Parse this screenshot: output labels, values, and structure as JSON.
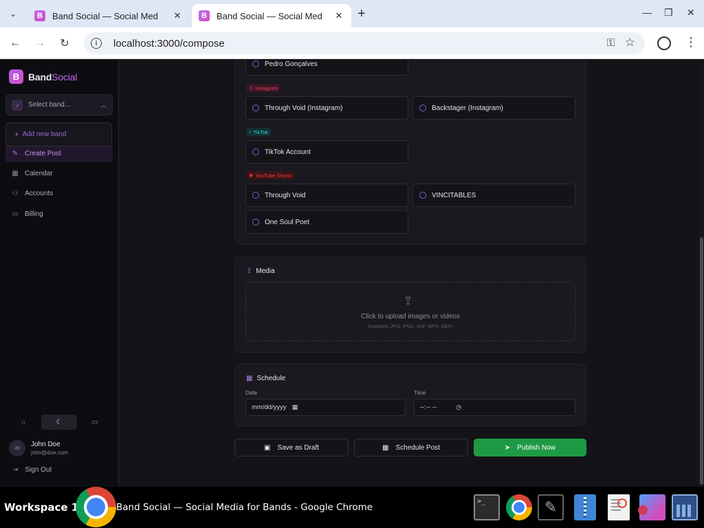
{
  "browser": {
    "tabs": [
      {
        "title": "Band Social — Social Med",
        "active": false
      },
      {
        "title": "Band Social — Social Med",
        "active": true
      }
    ],
    "url": "localhost:3000/compose"
  },
  "sidebar": {
    "brand_first": "Band",
    "brand_second": "Social",
    "band_select_placeholder": "Select band...",
    "dropdown_add_band": "Add new band",
    "nav": [
      {
        "label": "Create Post",
        "icon": "edit-icon",
        "active": true
      },
      {
        "label": "Calendar",
        "icon": "calendar-icon",
        "active": false
      },
      {
        "label": "Accounts",
        "icon": "user-icon",
        "active": false
      },
      {
        "label": "Billing",
        "icon": "credit-card-icon",
        "active": false
      }
    ],
    "theme_selected": "dark",
    "user": {
      "initials": "JD",
      "name": "John Doe",
      "email": "john@doe.com"
    },
    "sign_out": "Sign Out"
  },
  "accounts": {
    "partial_account": "Pedro Gonçalves",
    "groups": [
      {
        "platform": "Instagram",
        "color": "#e0456a",
        "accounts": [
          "Through Void (Instagram)",
          "Backstager (Instagram)"
        ]
      },
      {
        "platform": "TikTok",
        "color": "#3fd3d9",
        "accounts": [
          "TikTok Account"
        ]
      },
      {
        "platform": "YouTube Shorts",
        "color": "#f03a3a",
        "accounts": [
          "Through Void",
          "VINCITABLES",
          "One Soul Poet"
        ]
      }
    ]
  },
  "media": {
    "title": "Media",
    "upload_text": "Click to upload images or videos",
    "upload_hint": "Supports JPG, PNG, GIF, MP4, MOV"
  },
  "schedule": {
    "title": "Schedule",
    "date_label": "Date",
    "date_value": "mm/dd/yyyy",
    "time_label": "Time",
    "time_value": "--:-- --"
  },
  "actions": {
    "save_draft": "Save as Draft",
    "schedule_post": "Schedule Post",
    "publish_now": "Publish Now"
  },
  "taskbar": {
    "workspace": "Workspace 1",
    "window_title": "Band Social — Social Media for Bands - Google Chrome"
  },
  "colors": {
    "accent": "#b45ef0",
    "publish": "#1e9a45",
    "background": "#141318"
  }
}
